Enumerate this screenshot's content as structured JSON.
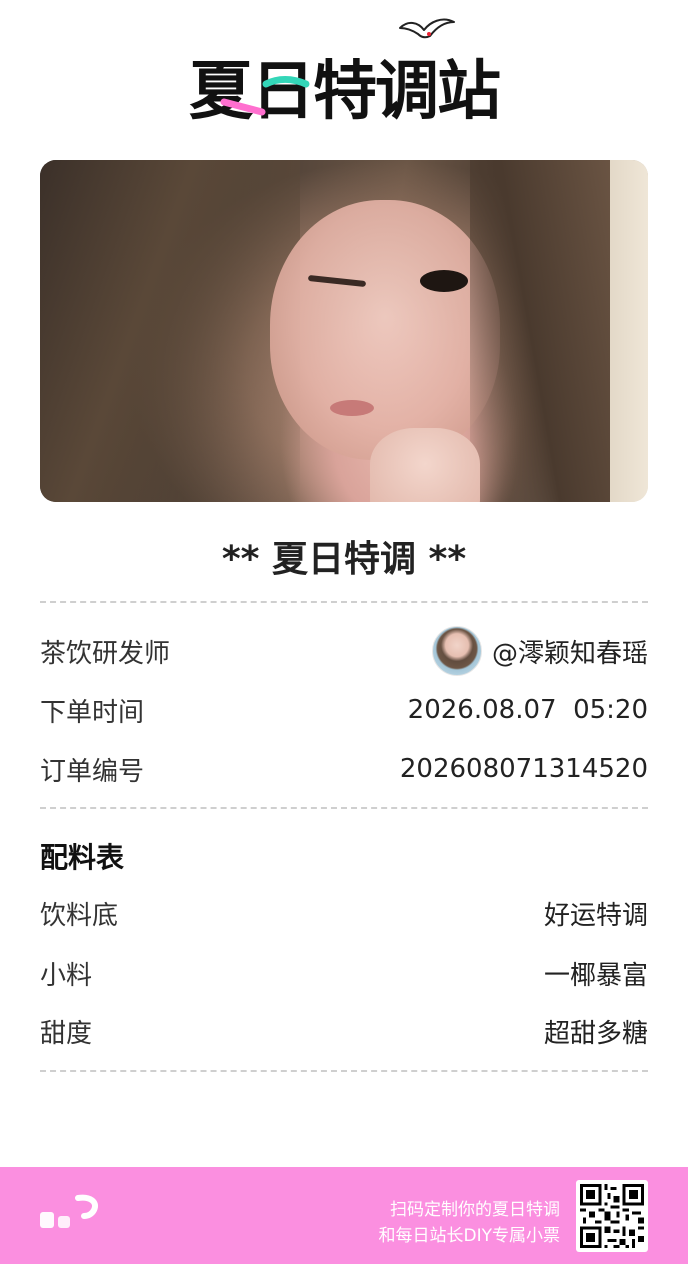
{
  "header": {
    "logo_text": "夏日特调站",
    "logo_icon": "seagull-icon"
  },
  "photo": {
    "alt": "portrait-photo"
  },
  "receipt": {
    "title": "** 夏日特调 **",
    "rows": [
      {
        "label": "茶饮研发师",
        "value": "@澪颖知春瑶",
        "avatar": true
      },
      {
        "label": "下单时间",
        "value": "2026.08.07  05:20"
      },
      {
        "label": "订单编号",
        "value": "202608071314520"
      }
    ],
    "ingredients_title": "配料表",
    "ingredients": [
      {
        "label": "饮料底",
        "value": "好运特调"
      },
      {
        "label": "小料",
        "value": "一椰暴富"
      },
      {
        "label": "甜度",
        "value": "超甜多糖"
      }
    ]
  },
  "footer": {
    "line1": "扫码定制你的夏日特调",
    "line2": "和每日站长DIY专属小票",
    "qr_icon": "qr-code-icon",
    "background": "#fb8fe0"
  },
  "colors": {
    "accent_pink": "#fb8fe0",
    "accent_teal": "#33d6b8",
    "logo_pink": "#ff6fcf"
  }
}
